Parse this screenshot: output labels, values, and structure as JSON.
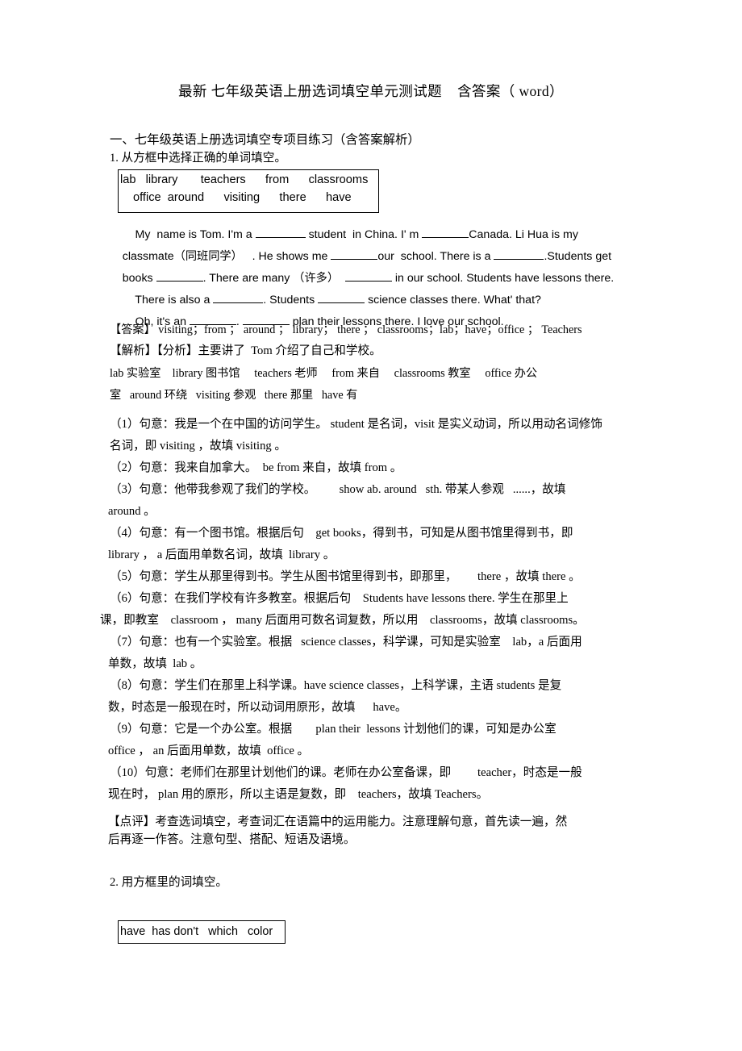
{
  "document": {
    "title": "最新 七年级英语上册选词填空单元测试题    含答案（ word）",
    "section_heading": "一、七年级英语上册选词填空专项目练习（含答案解析）"
  },
  "question1": {
    "number_and_prompt": "1. 从方框中选择正确的单词填空。",
    "word_bank": {
      "row1": "lab   library       teachers      from      classrooms",
      "row2": "office  around      visiting      there      have"
    },
    "passage": {
      "line1_a": "    My  name is Tom. I'm a ",
      "line1_b": " student  in China. I' m ",
      "line1_c": "Canada. Li Hua is my",
      "line2_a": "classmate（同班同学）   . He shows me ",
      "line2_b": "our  school. There is a ",
      "line2_c": ".Students get",
      "line3_a": "books ",
      "line3_b": ". There are many （许多）  ",
      "line3_c": " in our school. Students have lessons there.",
      "line4_a": "    There is also a ",
      "line4_b": ". Students ",
      "line4_c": " science classes there. What' that?",
      "line5_a": "    Oh, it's an ",
      "line5_b": ". ",
      "line5_c": " plan their lessons there. I love our school."
    },
    "answer_line": "【答案】 visiting；from ； around ； library； there ； classrooms；lab；have；office ； Teachers",
    "analysis_heading": "【解析】【分析】主要讲了  Tom 介绍了自己和学校。",
    "glossary_line1": "lab 实验室    library 图书馆     teachers 老师     from 来自     classrooms 教室     office 办公",
    "glossary_line2": "室   around 环绕   visiting 参观   there 那里   have 有",
    "explanations": [
      "（1）句意：我是一个在中国的访问学生。 student 是名词，visit 是实义动词，所以用动名词修饰",
      "名词，即 visiting ，故填 visiting 。",
      "（2）句意：我来自加拿大。  be from 来自，故填 from 。",
      "（3）句意：他带我参观了我们的学校。        show ab. around   sth. 带某人参观   ......，故填",
      "around 。",
      "（4）句意：有一个图书馆。根据后句    get books，得到书，可知是从图书馆里得到书，即",
      "library ， a 后面用单数名词，故填  library 。",
      "（5）句意：学生从那里得到书。学生从图书馆里得到书，即那里，       there ，故填 there 。",
      "（6）句意：在我们学校有许多教室。根据后句    Students have lessons there. 学生在那里上",
      "课，即教室    classroom ， many 后面用可数名词复数，所以用    classrooms，故填 classrooms。",
      "（7）句意：也有一个实验室。根据   science classes，科学课，可知是实验室    lab，a 后面用",
      "单数，故填  lab 。",
      "（8）句意：学生们在那里上科学课。have science classes，上科学课，主语 students 是复",
      "数，时态是一般现在时，所以动词用原形，故填      have。",
      "（9）句意：它是一个办公室。根据        plan their  lessons 计划他们的课，可知是办公室",
      "office ， an 后面用单数，故填  office 。",
      "（10）句意：老师们在那里计划他们的课。老师在办公室备课，即         teacher，时态是一般",
      "现在时， plan 用的原形，所以主语是复数，即    teachers，故填 Teachers。"
    ],
    "comment_line1": "【点评】考查选词填空，考查词汇在语篇中的运用能力。注意理解句意，首先读一遍，然",
    "comment_line2": "后再逐一作答。注意句型、搭配、短语及语境。"
  },
  "question2": {
    "number_and_prompt": "2. 用方框里的词填空。",
    "word_bank": {
      "row1": "have  has don't   which   color"
    }
  },
  "colors": {
    "text": "#000000",
    "background": "#ffffff",
    "border": "#000000"
  }
}
